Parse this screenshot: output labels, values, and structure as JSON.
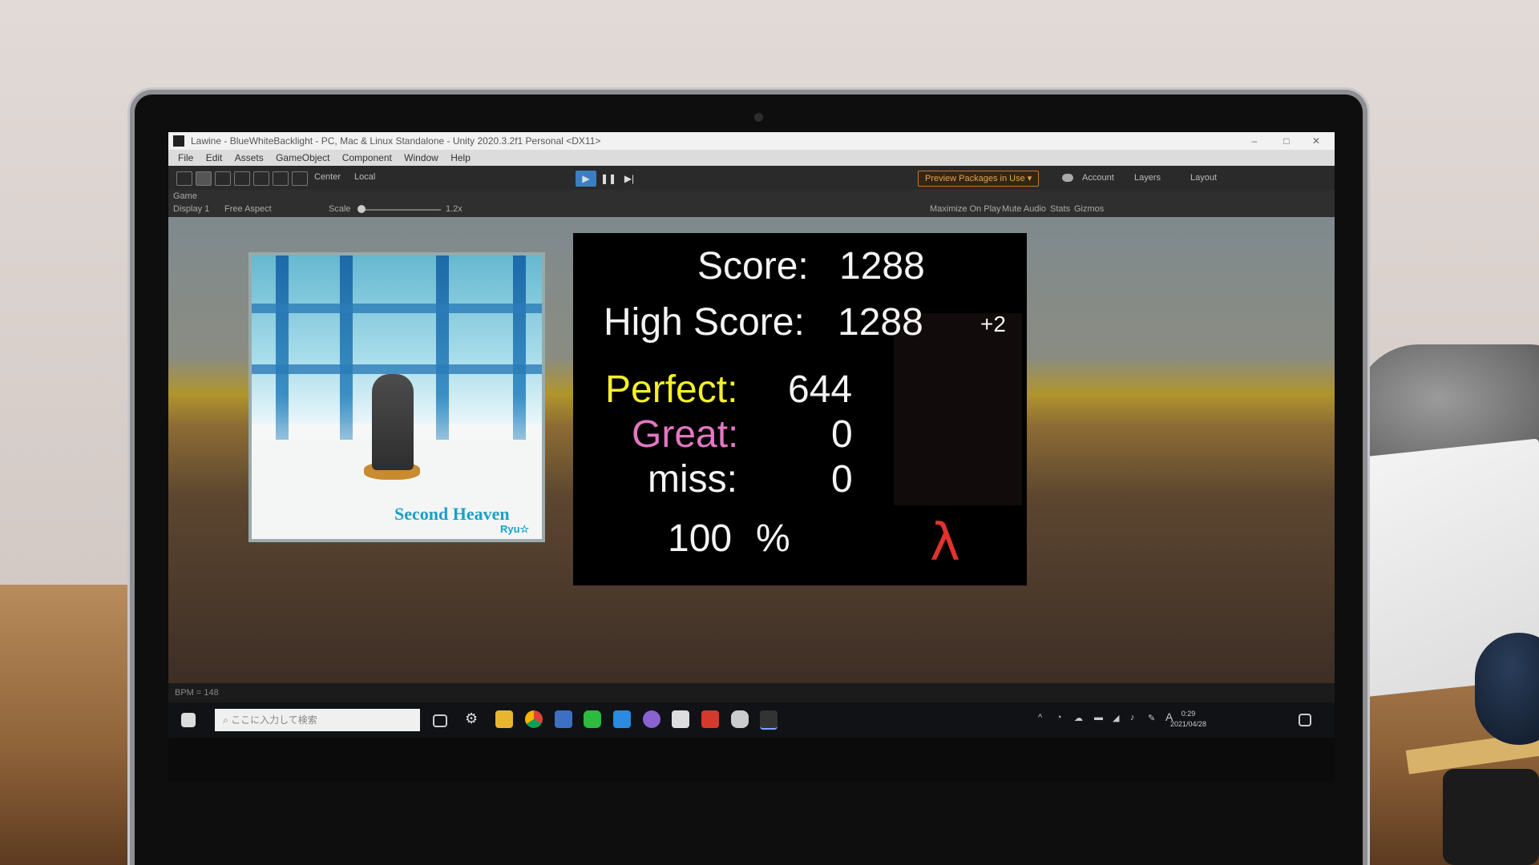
{
  "window": {
    "title": "Lawine - BlueWhiteBacklight - PC, Mac & Linux Standalone - Unity 2020.3.2f1 Personal <DX11>"
  },
  "menu": [
    "File",
    "Edit",
    "Assets",
    "GameObject",
    "Component",
    "Window",
    "Help"
  ],
  "toolbar": {
    "pivot_label": "Center",
    "space_label": "Local",
    "preview_packages": "Preview Packages in Use ▾",
    "account": "Account",
    "layers": "Layers",
    "layout": "Layout"
  },
  "game_view": {
    "tab": "Game",
    "display": "Display 1",
    "aspect": "Free Aspect",
    "scale_label": "Scale",
    "scale_value": "1.2x",
    "options": [
      "Maximize On Play",
      "Mute Audio",
      "Stats",
      "Gizmos"
    ]
  },
  "cover": {
    "title": "Second Heaven",
    "artist": "Ryu☆"
  },
  "results": {
    "score_label": "Score:",
    "score_value": "1288",
    "high_label": "High Score:",
    "high_value": "1288",
    "diff": "+2",
    "perfect_label": "Perfect:",
    "perfect_value": "644",
    "great_label": "Great:",
    "great_value": "0",
    "miss_label": "miss:",
    "miss_value": "0",
    "accuracy": "100",
    "percent_sign": "%",
    "grade": "λ"
  },
  "status": {
    "text": "BPM = 148"
  },
  "taskbar": {
    "search_placeholder": "ここに入力して検索",
    "ime": "A",
    "time": "0:29",
    "date": "2021/04/28"
  },
  "colors": {
    "perfect": "#f3ef2a",
    "great": "#e277c3",
    "grade": "#e0332d",
    "play_active": "#3a7fc4"
  }
}
